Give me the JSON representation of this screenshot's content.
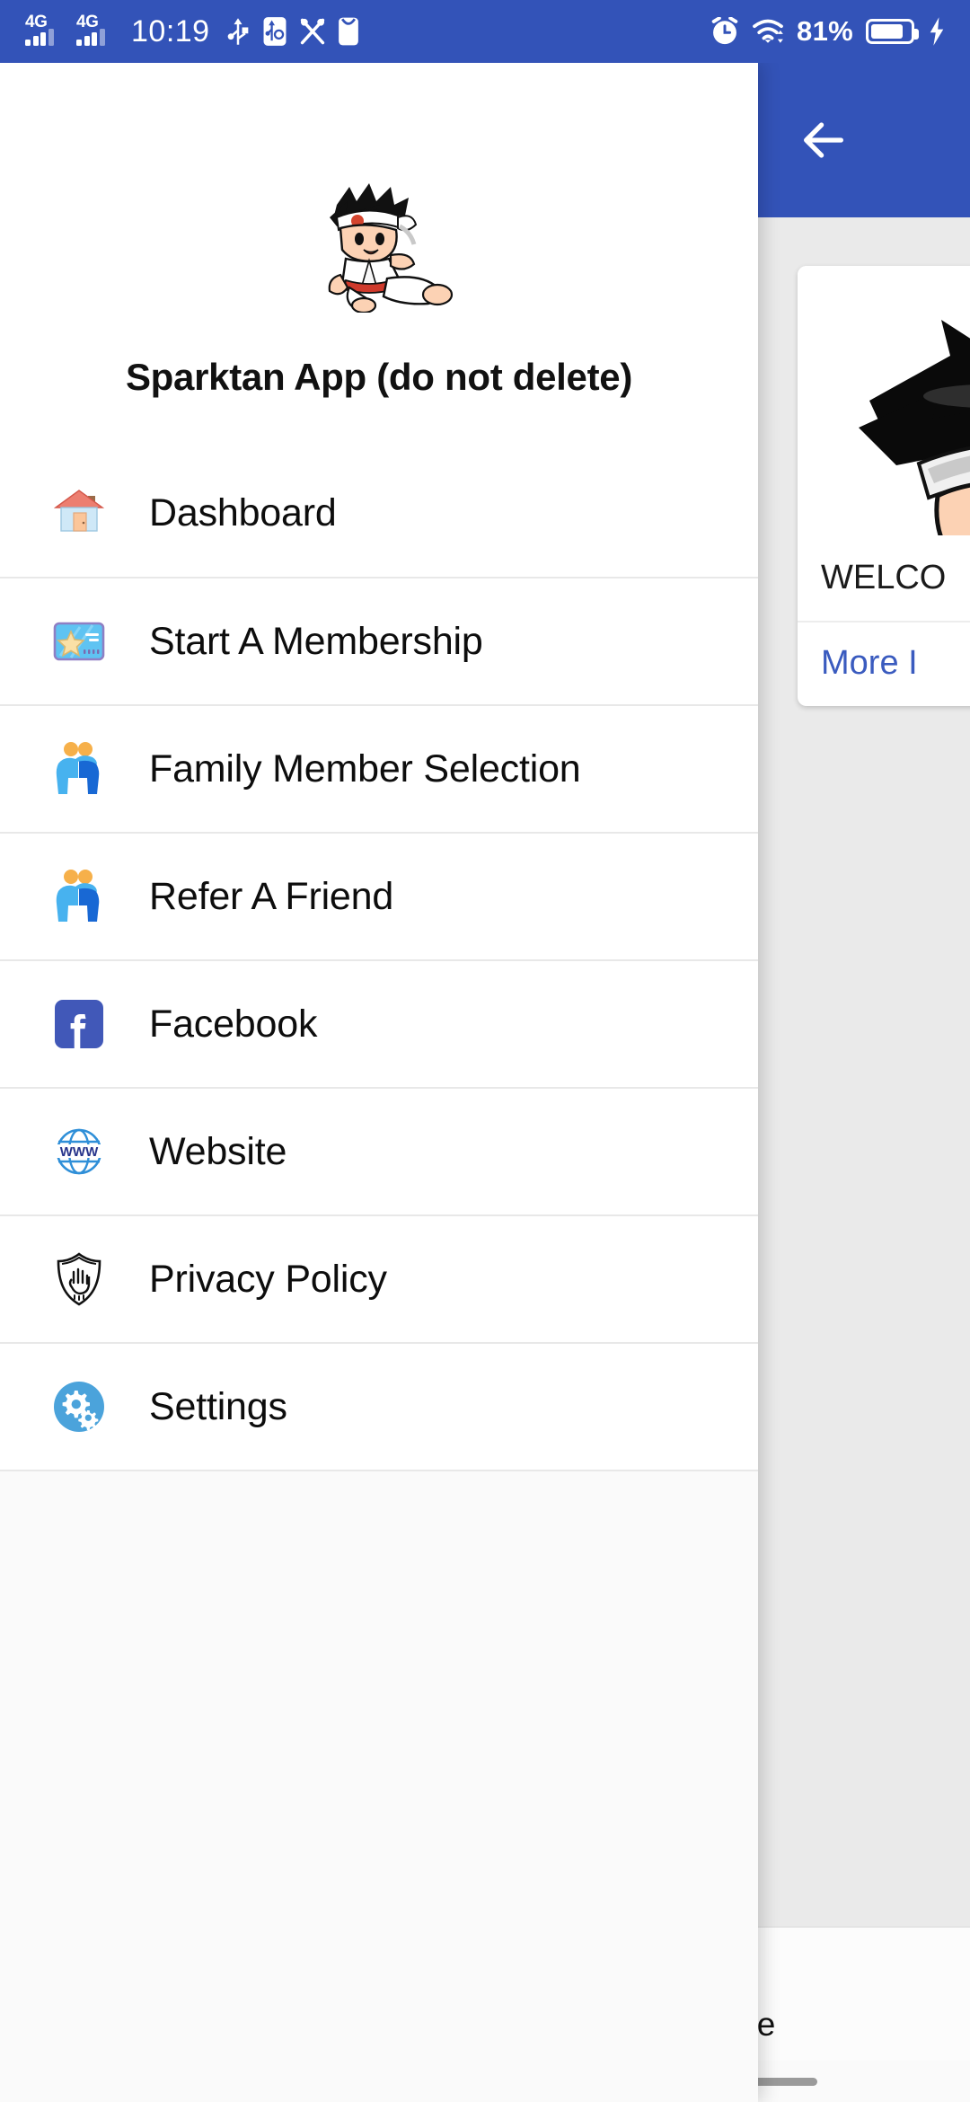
{
  "statusbar": {
    "network_1": "4G",
    "network_2": "4G",
    "time": "10:19",
    "icons": [
      "usb-icon",
      "usb-debug-icon",
      "developer-tools-icon",
      "mail-icon",
      "alarm-icon",
      "wifi-icon"
    ],
    "battery_percent": "81%",
    "charging": true
  },
  "background_page": {
    "back_button": "back-arrow-icon",
    "card": {
      "image": "cartoon-character-face",
      "title": "WELCO",
      "action_label": "More I"
    },
    "bottom_nav": [
      {
        "label": "Home",
        "icon": "home-icon",
        "active": true
      }
    ]
  },
  "drawer": {
    "logo": "karate-kid-mascot",
    "title": "Sparktan App (do not delete)",
    "items": [
      {
        "label": "Dashboard",
        "icon": "house-emoji-icon"
      },
      {
        "label": "Start A Membership",
        "icon": "ticket-star-icon"
      },
      {
        "label": "Family Member Selection",
        "icon": "people-hugging-icon"
      },
      {
        "label": "Refer A Friend",
        "icon": "people-hugging-icon"
      },
      {
        "label": "Facebook",
        "icon": "facebook-icon"
      },
      {
        "label": "Website",
        "icon": "www-globe-icon"
      },
      {
        "label": "Privacy Policy",
        "icon": "shield-hand-icon"
      },
      {
        "label": "Settings",
        "icon": "gears-circle-icon"
      }
    ]
  },
  "colors": {
    "primary_blue": "#3353b8",
    "link_blue": "#3a5bbf",
    "facebook_blue": "#4158b8",
    "settings_blue": "#4ba3db",
    "scrim": "#eaeaea"
  }
}
